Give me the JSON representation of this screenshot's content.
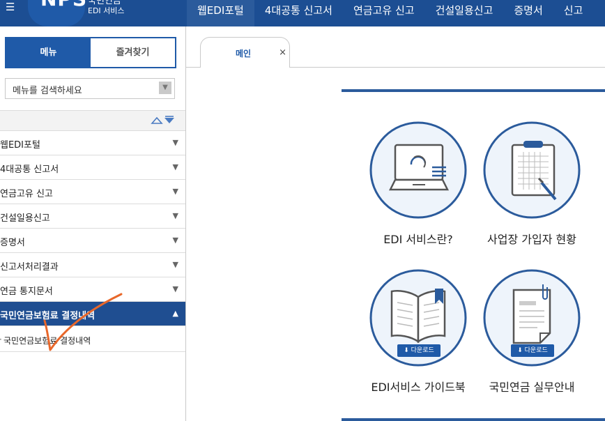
{
  "header": {
    "menu_icon": "hamburger-icon",
    "logo": {
      "en": "NPS",
      "ko": "국민연금",
      "sub": "EDI 서비스"
    },
    "nav": [
      {
        "label": "웹EDI포털",
        "active": true
      },
      {
        "label": "4대공통 신고서",
        "active": false
      },
      {
        "label": "연금고유 신고",
        "active": false
      },
      {
        "label": "건설일용신고",
        "active": false
      },
      {
        "label": "증명서",
        "active": false
      },
      {
        "label": "신고",
        "active": false
      }
    ]
  },
  "sidebar": {
    "tabs": {
      "menu": "메뉴",
      "favorites": "즐겨찾기"
    },
    "search": {
      "placeholder": "메뉴를 검색하세요"
    },
    "tree_toggle_icon": "expand-collapse-icon",
    "items": [
      {
        "label": "웹EDI포털",
        "arrow": "▼",
        "active": false
      },
      {
        "label": "4대공통 신고서",
        "arrow": "▼",
        "active": false
      },
      {
        "label": "연금고유 신고",
        "arrow": "▼",
        "active": false
      },
      {
        "label": "건설일용신고",
        "arrow": "▼",
        "active": false
      },
      {
        "label": "증명서",
        "arrow": "▼",
        "active": false
      },
      {
        "label": "신고서처리결과",
        "arrow": "▼",
        "active": false
      },
      {
        "label": "연금 통지문서",
        "arrow": "▼",
        "active": false
      },
      {
        "label": "국민연금보험료 결정내역",
        "arrow": "▲",
        "active": true
      }
    ],
    "sub_item": {
      "bullet": "·",
      "label": "국민연금보험료 결정내역"
    },
    "annotation": {
      "color": "#e8672a",
      "shape": "checkmark"
    }
  },
  "content": {
    "tab": {
      "label": "메인",
      "close": "×"
    },
    "accent": "#2b5b9c",
    "cards": [
      {
        "label": "EDI 서비스란?",
        "icon": "laptop-icon",
        "download": ""
      },
      {
        "label": "사업장 가입자 현황",
        "icon": "clipboard-icon",
        "download": ""
      },
      {
        "label": "EDI서비스 가이드북",
        "icon": "book-icon",
        "download": "다운로드"
      },
      {
        "label": "국민연금 실무안내",
        "icon": "document-icon",
        "download": "다운로드"
      }
    ]
  }
}
